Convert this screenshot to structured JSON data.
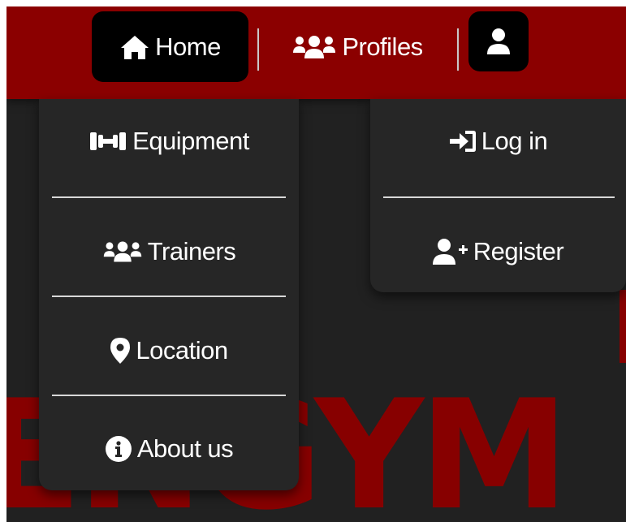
{
  "nav": {
    "home_label": "Home",
    "profiles_label": "Profiles",
    "home_icon": "home-icon",
    "profiles_icon": "users-icon",
    "account_icon": "user-icon"
  },
  "profiles_menu": {
    "items": [
      {
        "label": "Equipment",
        "icon": "dumbbell-icon"
      },
      {
        "label": "Trainers",
        "icon": "users-icon"
      },
      {
        "label": "Location",
        "icon": "map-marker-icon"
      },
      {
        "label": "About us",
        "icon": "info-circle-icon"
      }
    ]
  },
  "account_menu": {
    "items": [
      {
        "label": "Log in",
        "icon": "sign-in-icon"
      },
      {
        "label": "Register",
        "icon": "user-plus-icon"
      }
    ]
  },
  "background": {
    "word": "ENGYM"
  },
  "colors": {
    "brand_red": "#8b0000",
    "panel": "#262626",
    "page": "#212121",
    "active_tab": "#000000"
  }
}
